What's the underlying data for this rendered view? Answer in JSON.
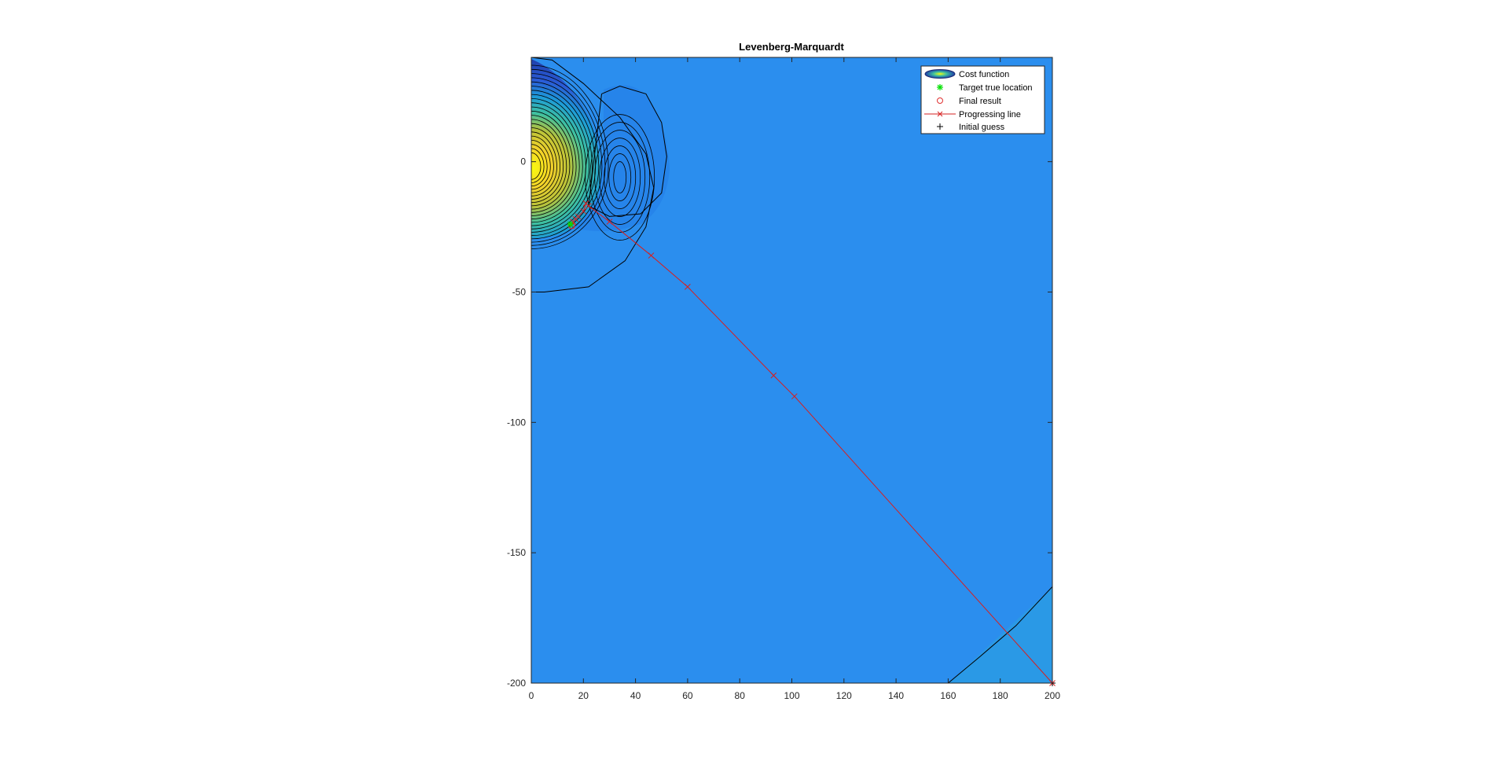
{
  "figure": {
    "background": "#ffffff",
    "plot_background": "#2b8eee"
  },
  "chart_data": {
    "type": "contour",
    "title": "Levenberg-Marquardt",
    "xlabel": "",
    "ylabel": "",
    "xlim": [
      0,
      200
    ],
    "ylim": [
      -200,
      40
    ],
    "x_ticks": [
      0,
      20,
      40,
      60,
      80,
      100,
      120,
      140,
      160,
      180,
      200
    ],
    "y_ticks": [
      -200,
      -150,
      -100,
      -50,
      0
    ],
    "x_tick_labels": [
      "0",
      "20",
      "40",
      "60",
      "80",
      "100",
      "120",
      "140",
      "160",
      "180",
      "200"
    ],
    "y_tick_labels": [
      "-200",
      "-150",
      "-100",
      "-50",
      "0"
    ],
    "grid": false,
    "legend_position": "top-right",
    "colormap": "parula",
    "legend": [
      {
        "key": "cost",
        "label": "Cost function",
        "marker": "contour-swatch",
        "color": "#1e3ea8"
      },
      {
        "key": "target",
        "label": "Target true location",
        "marker": "asterisk",
        "color": "#00e000"
      },
      {
        "key": "final",
        "label": "Final result",
        "marker": "circle",
        "color": "#e03030"
      },
      {
        "key": "progress",
        "label": "Progressing line",
        "marker": "x-line",
        "color": "#d62020"
      },
      {
        "key": "initial",
        "label": "Initial guess",
        "marker": "plus",
        "color": "#000000"
      }
    ],
    "target_true_location": {
      "x": 15,
      "y": -24
    },
    "final_result": {
      "x": 15.5,
      "y": -24.5
    },
    "initial_guess": {
      "x": 200,
      "y": -200
    },
    "progressing_line": {
      "x": [
        200,
        101,
        93,
        60,
        46,
        30,
        22,
        21,
        20,
        18,
        17,
        16,
        15.5
      ],
      "y": [
        -200,
        -90,
        -82,
        -48,
        -36,
        -23,
        -17,
        -16,
        -19,
        -21,
        -22,
        -23,
        -24.5
      ]
    },
    "cost_function": {
      "peak": {
        "x": 0,
        "y": -2
      },
      "high_color": "#f9fb0e",
      "mid_color": "#3ec0a0",
      "low_color": "#1e3ea8",
      "base_color": "#2b8eee",
      "corner_color": "#2a99e6",
      "contours": [
        {
          "x": [
            0,
            8,
            20,
            34,
            44,
            47,
            44,
            36,
            22,
            5,
            0
          ],
          "y": [
            40,
            39,
            30,
            17,
            3,
            -10,
            -25,
            -38,
            -48,
            -50,
            -50
          ]
        },
        {
          "x": [
            27,
            34,
            44,
            50,
            52,
            50,
            42,
            30,
            22,
            27
          ],
          "y": [
            26,
            29,
            26,
            15,
            2,
            -12,
            -20,
            -21,
            -17,
            26
          ]
        },
        {
          "x": [
            160,
            172,
            186,
            200
          ],
          "y": [
            -200,
            -190,
            -178,
            -163
          ]
        }
      ]
    }
  }
}
